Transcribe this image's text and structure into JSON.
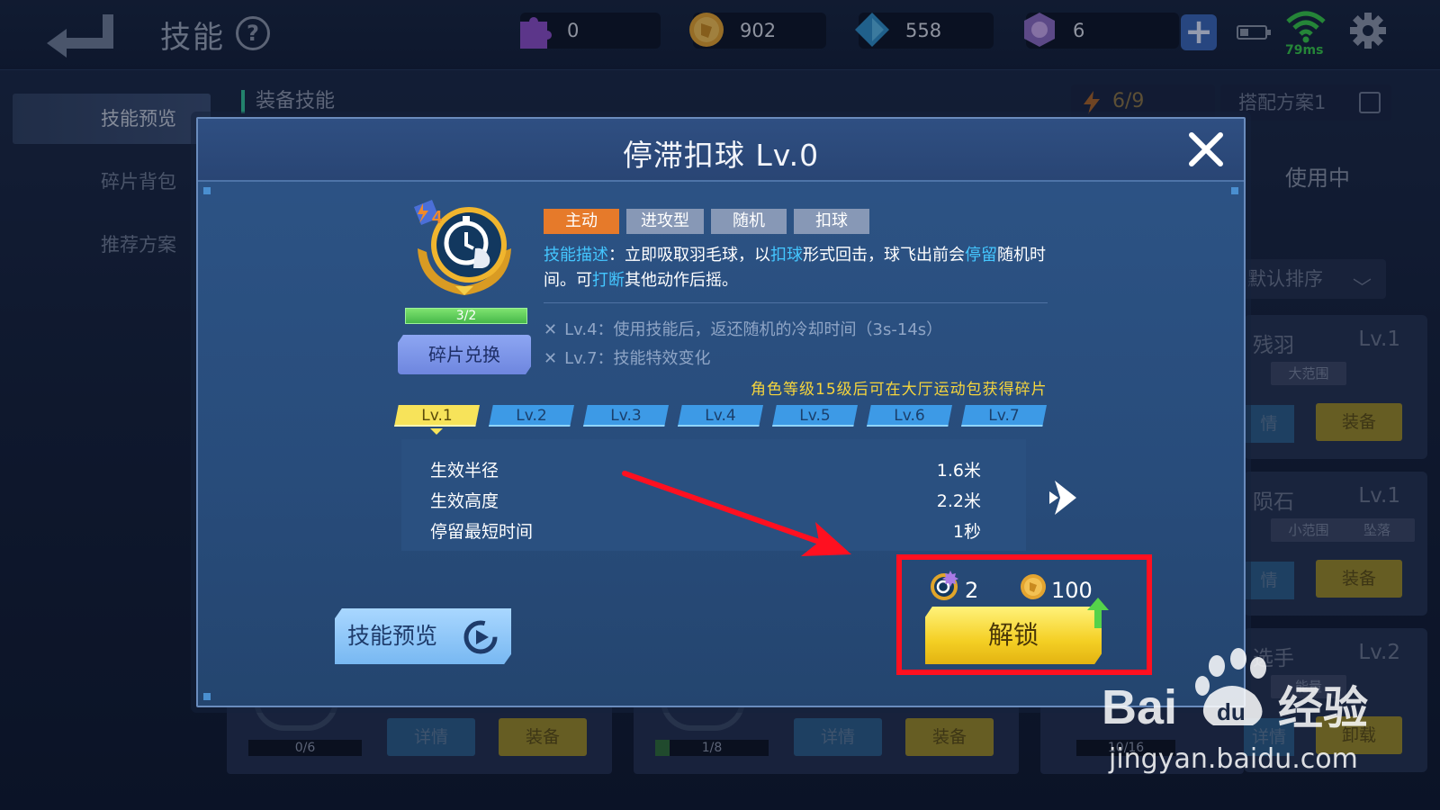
{
  "header": {
    "title": "技能",
    "help_symbol": "?",
    "resources": [
      {
        "icon": "puzzle-fragment-icon",
        "value": "0",
        "color": "#9a55d6"
      },
      {
        "icon": "gold-coin-icon",
        "value": "902",
        "color": "#f0b53a"
      },
      {
        "icon": "blue-diamond-icon",
        "value": "558",
        "color": "#3d9fd6"
      },
      {
        "icon": "purple-gem-icon",
        "value": "6",
        "color": "#a57adf"
      }
    ],
    "add_symbol": "+",
    "battery_level": 0.35,
    "ping": "79ms"
  },
  "sidebar": {
    "items": [
      {
        "label": "技能预览",
        "active": true
      },
      {
        "label": "碎片背包",
        "active": false
      },
      {
        "label": "推荐方案",
        "active": false
      }
    ]
  },
  "background": {
    "equip_title": "装备技能",
    "energy": "6/9",
    "plan": "搭配方案1",
    "in_use": "使用中",
    "sort": "默认排序",
    "cards": [
      {
        "name": "残羽",
        "level": "Lv.1",
        "tags": [
          "大范围"
        ],
        "detail": "情",
        "equip": "装备"
      },
      {
        "name": "陨石",
        "level": "Lv.1",
        "tags": [
          "小范围",
          "坠落"
        ],
        "detail": "情",
        "equip": "装备"
      },
      {
        "name": "选手",
        "level": "Lv.2",
        "tags": [
          "能量"
        ],
        "detail": "详情",
        "equip": "卸载"
      }
    ],
    "bottom_cards": [
      {
        "progress": "0/6",
        "progress_fraction": 0,
        "detail": "详情",
        "equip": "装备"
      },
      {
        "progress": "1/8",
        "progress_fraction": 0.125,
        "detail": "详情",
        "equip": "装备"
      },
      {
        "progress": "10/16"
      }
    ]
  },
  "modal": {
    "title": "停滞扣球  Lv.0",
    "badge_number": "4",
    "fragment_progress": "3/2",
    "fragment_fraction": 1.0,
    "exchange_label": "碎片兑换",
    "tags": [
      {
        "label": "主动",
        "style": "orange"
      },
      {
        "label": "进攻型",
        "style": "gray"
      },
      {
        "label": "随机",
        "style": "gray"
      },
      {
        "label": "扣球",
        "style": "gray"
      }
    ],
    "description": {
      "label": "技能描述",
      "colon": "：",
      "p1": "立即吸取羽毛球，以",
      "hl1": "扣球",
      "p2": "形式回击，球飞出前会",
      "hl2": "停留",
      "p3": "随机时间。可",
      "hl3": "打断",
      "p4": "其他动作后摇。"
    },
    "level_notes": [
      "Lv.4：使用技能后，返还随机的冷却时间（3s-14s）",
      "Lv.7：技能特效变化"
    ],
    "hint": "角色等级15级后可在大厅运动包获得碎片",
    "level_tabs": [
      "Lv.1",
      "Lv.2",
      "Lv.3",
      "Lv.4",
      "Lv.5",
      "Lv.6",
      "Lv.7"
    ],
    "active_level_index": 0,
    "stats": [
      {
        "key": "生效半径",
        "value": "1.6米"
      },
      {
        "key": "生效高度",
        "value": "2.2米"
      },
      {
        "key": "停留最短时间",
        "value": "1秒"
      }
    ],
    "preview_label": "技能预览",
    "cost": {
      "fragments": "2",
      "coins": "100"
    },
    "unlock_label": "解锁"
  },
  "watermark": {
    "brand_left": "Bai",
    "brand_right": "经验",
    "url": "jingyan.baidu.com"
  }
}
